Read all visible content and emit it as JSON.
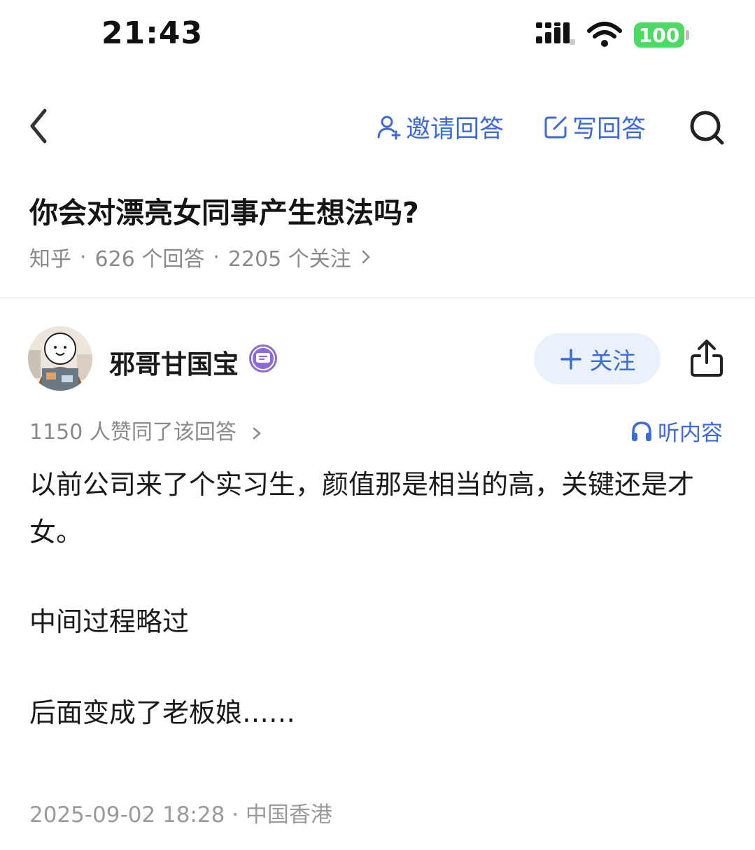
{
  "status_bar": {
    "time": "21:43",
    "battery": "100",
    "icons": [
      "cellular-signal-icon",
      "wifi-icon",
      "battery-icon"
    ]
  },
  "nav": {
    "back_icon": "chevron-left-icon",
    "invite_label": "邀请回答",
    "write_label": "写回答",
    "search_icon": "search-icon",
    "accent_color": "#3c6ad6"
  },
  "question": {
    "title": "你会对漂亮女同事产生想法吗?",
    "source": "知乎",
    "answers": "626 个回答",
    "followers": "2205 个关注",
    "separator": "·"
  },
  "answer": {
    "author": "邪哥甘国宝",
    "follow_label": "关注",
    "likes_text": "1150 人赞同了该回答",
    "listen_label": "听内容",
    "paragraphs": [
      "以前公司来了个实习生，颜值那是相当的高，关键还是才女。",
      "中间过程略过",
      "后面变成了老板娘……"
    ],
    "footer": "2025-09-02 18:28 · 中国香港"
  }
}
